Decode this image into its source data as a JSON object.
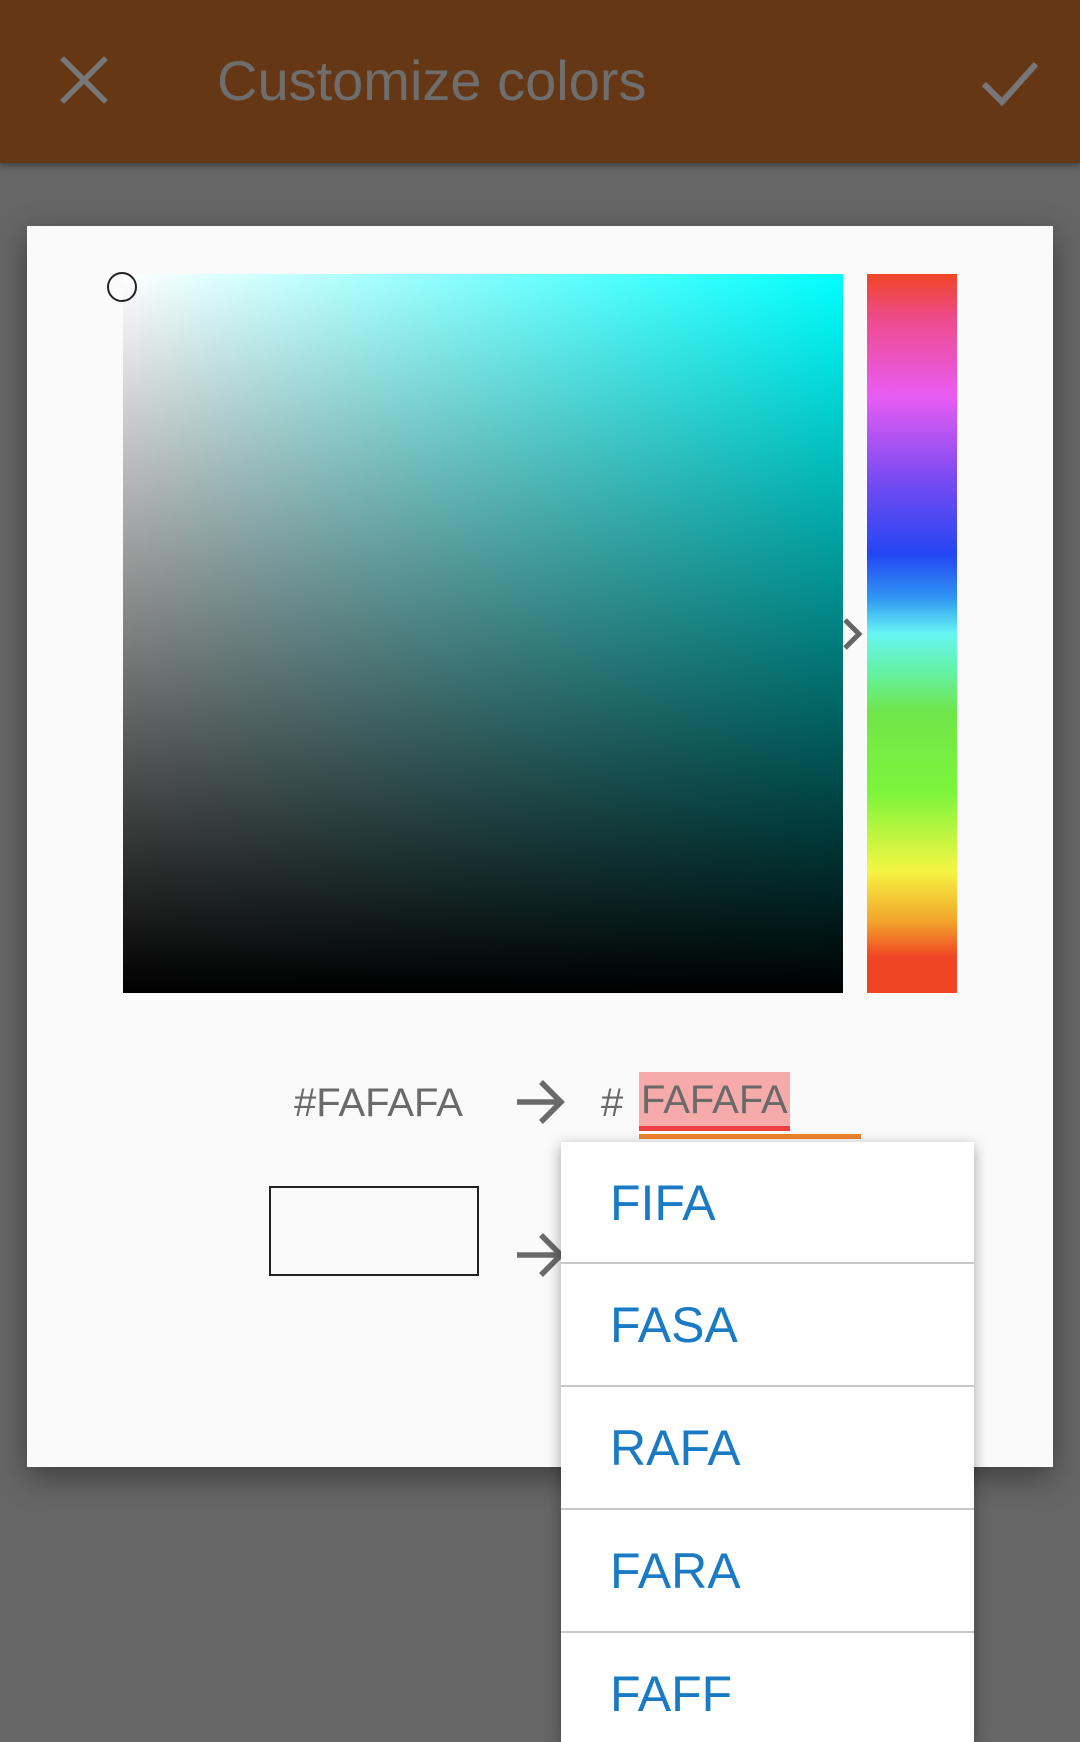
{
  "appbar": {
    "title": "Customize colors",
    "close_icon": "close-icon",
    "done_icon": "check-icon",
    "background": "#653715"
  },
  "picker": {
    "hue_color": "#00ffff",
    "old_hex": "#FAFAFA",
    "hash": "#",
    "hex_input_value": "FAFAFA",
    "old_swatch_color": "#FAFAFA",
    "arrow_icon": "arrow-right-icon"
  },
  "suggestions": [
    {
      "label": "FIFA"
    },
    {
      "label": "FASA"
    },
    {
      "label": "RAFA"
    },
    {
      "label": "FARA"
    },
    {
      "label": "FAFF"
    }
  ],
  "colors": {
    "suggestion_text": "#1a7bc4",
    "misspelling_underline": "#ee3f43",
    "field_underline": "#f0842c"
  }
}
